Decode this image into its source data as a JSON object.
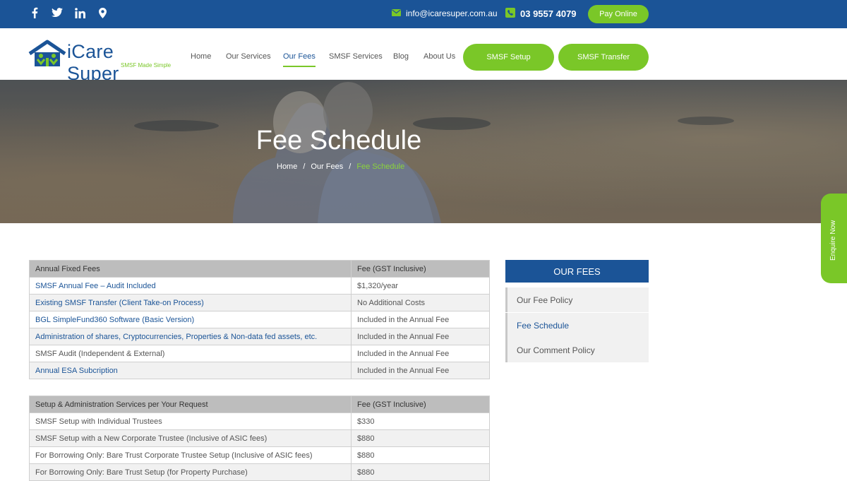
{
  "topbar": {
    "social_icons": [
      "facebook-icon",
      "twitter-icon",
      "linkedin-icon",
      "location-pin-icon"
    ],
    "email": "info@icaresuper.com.au",
    "phone": "03 9557 4079",
    "pay_label": "Pay Online",
    "bg_color": "#1b5497",
    "accent_color": "#7ac728"
  },
  "header": {
    "logo_name": "iCare Super",
    "logo_tagline": "SMSF Made Simple",
    "nav": [
      {
        "label": "Home"
      },
      {
        "label": "Our Services"
      },
      {
        "label": "Our Fees",
        "active": true
      },
      {
        "label": "SMSF Services"
      },
      {
        "label": "Blog"
      },
      {
        "label": "About Us"
      }
    ],
    "cta_setup": "SMSF Setup",
    "cta_transfer": "SMSF Transfer"
  },
  "hero": {
    "title": "Fee Schedule",
    "breadcrumb": [
      "Home",
      "Our Fees",
      "Fee Schedule"
    ],
    "separator": "/"
  },
  "enquire": "Enquire Now",
  "table1": {
    "headers": [
      "Annual Fixed Fees",
      "Fee (GST Inclusive)"
    ],
    "rows": [
      {
        "name": "SMSF Annual Fee – Audit Included",
        "fee": "$1,320/year",
        "link": true
      },
      {
        "name": "Existing SMSF Transfer (Client Take-on Process)",
        "fee": "No Additional Costs",
        "link": true
      },
      {
        "name": "BGL SimpleFund360 Software (Basic Version)",
        "fee": "Included in the Annual Fee",
        "link": true
      },
      {
        "name": "Administration of  shares, Cryptocurrencies, Properties & Non-data fed assets, etc.",
        "fee": "Included in the Annual Fee",
        "link": true
      },
      {
        "name": "SMSF Audit (Independent & External)",
        "fee": "Included in the Annual Fee",
        "link": false
      },
      {
        "name": "Annual ESA Subcription",
        "fee": "Included in the Annual Fee",
        "link": true
      }
    ]
  },
  "table2": {
    "headers": [
      "Setup & Administration Services per Your Request",
      "Fee (GST Inclusive)"
    ],
    "rows": [
      {
        "name": "SMSF Setup with Individual Trustees",
        "fee": "$330"
      },
      {
        "name": "SMSF Setup with a New Corporate Trustee (Inclusive of ASIC fees)",
        "fee": "$880"
      },
      {
        "name": "For Borrowing Only: Bare Trust Corporate Trustee Setup (Inclusive of ASIC fees)",
        "fee": "$880"
      },
      {
        "name": "For Borrowing Only: Bare Trust Setup (for Property Purchase)",
        "fee": "$880"
      }
    ]
  },
  "sidebar": {
    "title": "OUR FEES",
    "items": [
      {
        "label": "Our Fee Policy"
      },
      {
        "label": "Fee Schedule",
        "active": true
      },
      {
        "label": "Our Comment Policy"
      }
    ]
  }
}
